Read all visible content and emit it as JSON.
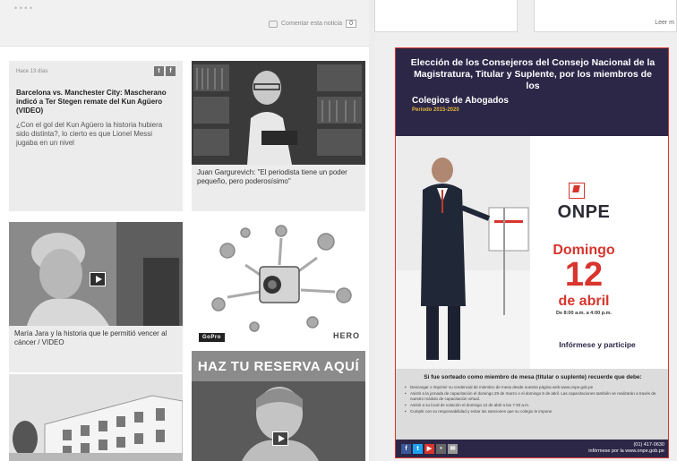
{
  "top_bar": {
    "comment_label": "Comentar esta noticia",
    "comment_count": "0"
  },
  "cards": [
    {
      "meta": "Hace 13 días",
      "title": "Barcelona vs. Manchester City: Mascherano indicó a Ter Stegen remate del Kun Agüero (VIDEO)",
      "summary": "¿Con el gol del Kun Agüero la historia hubiera sido distinta?, lo cierto es que Lionel Messi jugaba en un nivel"
    },
    {
      "caption": "Juan Gargurevich: \"El periodista tiene un poder pequeño, pero poderosísimo\""
    },
    {
      "caption": "María Jara y la historia que le permitió vencer al cáncer / VIDEO"
    }
  ],
  "gopro": {
    "logo": "GoPro",
    "product": "HERO"
  },
  "reserve_banner": "HAZ TU RESERVA AQUÍ",
  "right_top": {
    "right_link": "Leer m"
  },
  "onpe_ad": {
    "headline": "Elección de los Consejeros del Consejo Nacional de la Magistratura, Titular y Suplente, por los miembros de los",
    "subheadline": "Colegios de Abogados",
    "period": "Periodo 2015-2020",
    "brand": "ONPE",
    "day_name": "Domingo",
    "day_number": "12",
    "month": "de abril",
    "hours": "De 8:00 a.m. a 4:00 p.m.",
    "info": "Infórmese y participe",
    "question": "Si fue sorteado como miembro de mesa (titular o suplente) recuerde que debe:",
    "bullets": [
      "Descargar o imprimir su credencial de miembro de mesa desde nuestra página web www.onpe.gob.pe",
      "Asistir a la jornada de capacitación el domingo 29 de marzo o el domingo 5 de abril. Las capacitaciones también se realizarán a través de nuestro módulo de capacitación virtual.",
      "Asistir a su local de votación el domingo 12 de abril a las 7:30 a.m.",
      "Cumplir con su responsabilidad y evitar las sanciones que su colegio le impone."
    ],
    "contact_phone": "(01) 417-0630",
    "contact_web": "infórmese por la www.onpe.gob.pe"
  },
  "colors": {
    "onpe_navy": "#2c2647",
    "onpe_red": "#d7352d",
    "reserve_gray": "#8b8b8b"
  }
}
